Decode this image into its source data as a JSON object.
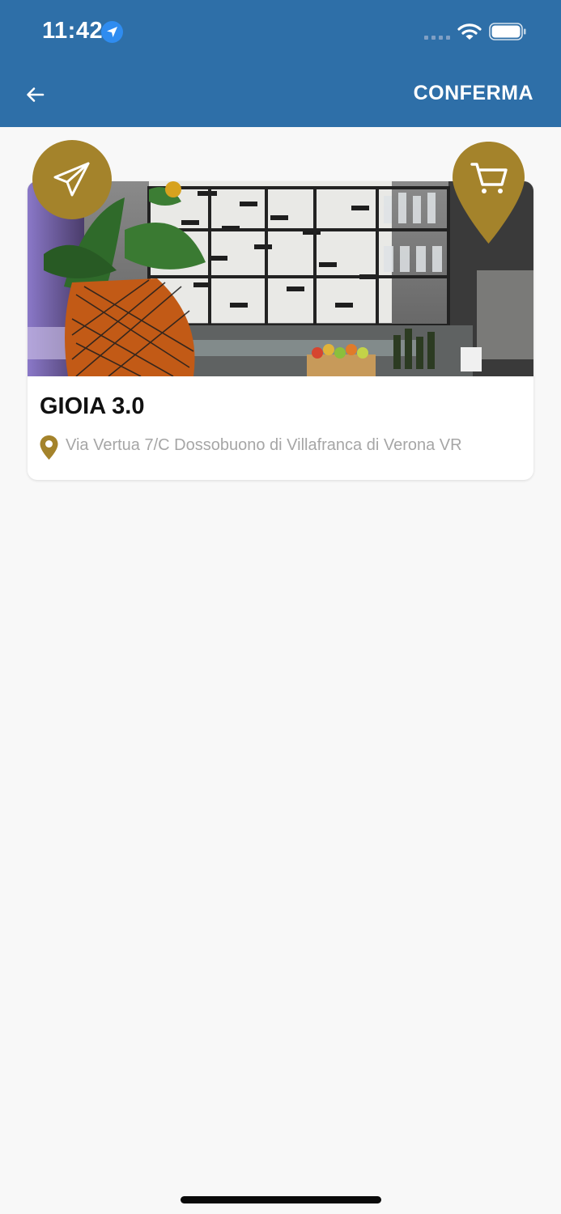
{
  "status_bar": {
    "time": "11:42",
    "location_icon": "location-arrow-icon",
    "signal_icon": "cellular-signal-icon",
    "wifi_icon": "wifi-icon",
    "battery_icon": "battery-icon"
  },
  "header": {
    "back_icon": "arrow-left-icon",
    "confirm_label": "CONFERMA"
  },
  "store_card": {
    "title": "GIOIA 3.0",
    "address": "Via Vertua 7/C Dossobuono di Villafranca di Verona VR",
    "photo": "shop-interior-photo",
    "send_badge_icon": "paper-plane-icon",
    "cart_badge_icon": "shopping-cart-icon",
    "address_icon": "map-pin-icon"
  },
  "colors": {
    "header_bg": "#2e6fa8",
    "accent_gold": "#a4832b",
    "address_text": "#a6a6a6",
    "page_bg": "#f8f8f8"
  }
}
